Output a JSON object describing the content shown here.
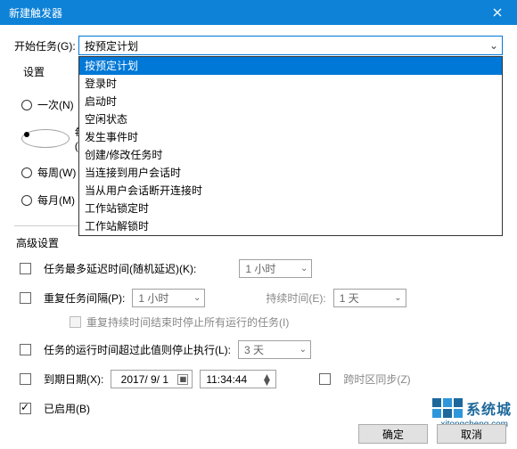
{
  "titlebar": {
    "title": "新建触发器"
  },
  "begin": {
    "label": "开始任务(G):",
    "selected": "按预定计划",
    "options": [
      "按预定计划",
      "登录时",
      "启动时",
      "空闲状态",
      "发生事件时",
      "创建/修改任务时",
      "当连接到用户会话时",
      "当从用户会话断开连接时",
      "工作站锁定时",
      "工作站解锁时"
    ]
  },
  "settings_label": "设置",
  "schedule": {
    "once": "一次(N)",
    "daily": "每天(D)",
    "weekly": "每周(W)",
    "monthly": "每月(M)",
    "selected": "daily"
  },
  "right_panel": {
    "tz_sync": "跨时区同步(Z)"
  },
  "advanced": {
    "title": "高级设置",
    "delay_label": "任务最多延迟时间(随机延迟)(K):",
    "delay_value": "1 小时",
    "repeat_label": "重复任务间隔(P):",
    "repeat_value": "1 小时",
    "duration_label": "持续时间(E):",
    "duration_value": "1 天",
    "repeat_stop": "重复持续时间结束时停止所有运行的任务(I)",
    "stop_label": "任务的运行时间超过此值则停止执行(L):",
    "stop_value": "3 天",
    "expire_label": "到期日期(X):",
    "expire_date": "2017/ 9/ 1",
    "expire_time": "11:34:44",
    "expire_tz": "跨时区同步(Z)",
    "enabled_label": "已启用(B)"
  },
  "footer": {
    "ok": "确定",
    "cancel": "取消"
  },
  "watermark": {
    "text": "系统城",
    "url": "xitongcheng.com"
  }
}
